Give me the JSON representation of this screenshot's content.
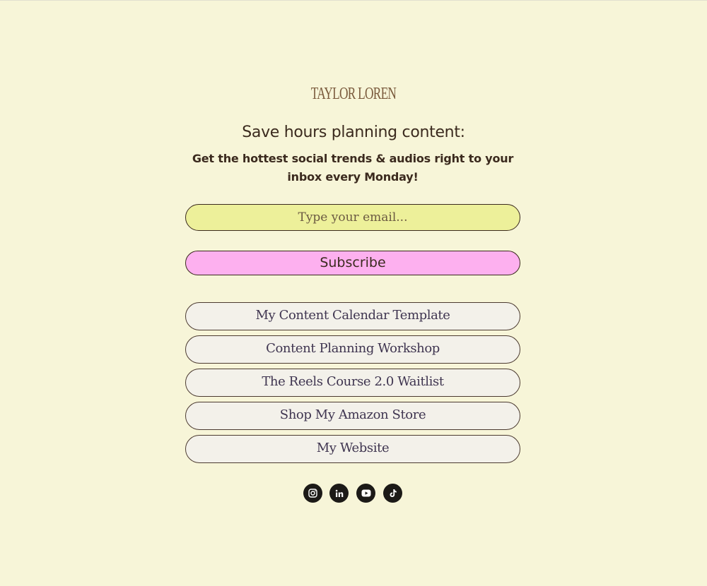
{
  "brand": {
    "logo_text": "TAYLOR LOREN"
  },
  "signup": {
    "headline": "Save hours planning content:",
    "subtext": "Get the hottest social trends & audios right to your inbox every Monday!",
    "email_placeholder": "Type your email...",
    "email_value": "",
    "subscribe_label": "Subscribe"
  },
  "links": [
    {
      "label": "My Content Calendar Template"
    },
    {
      "label": "Content Planning Workshop"
    },
    {
      "label": "The Reels Course 2.0 Waitlist"
    },
    {
      "label": "Shop My Amazon Store"
    },
    {
      "label": "My Website"
    }
  ],
  "social": [
    {
      "icon": "instagram-icon"
    },
    {
      "icon": "linkedin-icon"
    },
    {
      "icon": "youtube-icon"
    },
    {
      "icon": "tiktok-icon"
    }
  ],
  "colors": {
    "background": "#f7f5d8",
    "email_field": "#edf09a",
    "subscribe_button": "#fdb0ef",
    "link_button": "#f3f1ea",
    "text": "#3b2a1e",
    "icon_circle": "#1c1a17"
  }
}
